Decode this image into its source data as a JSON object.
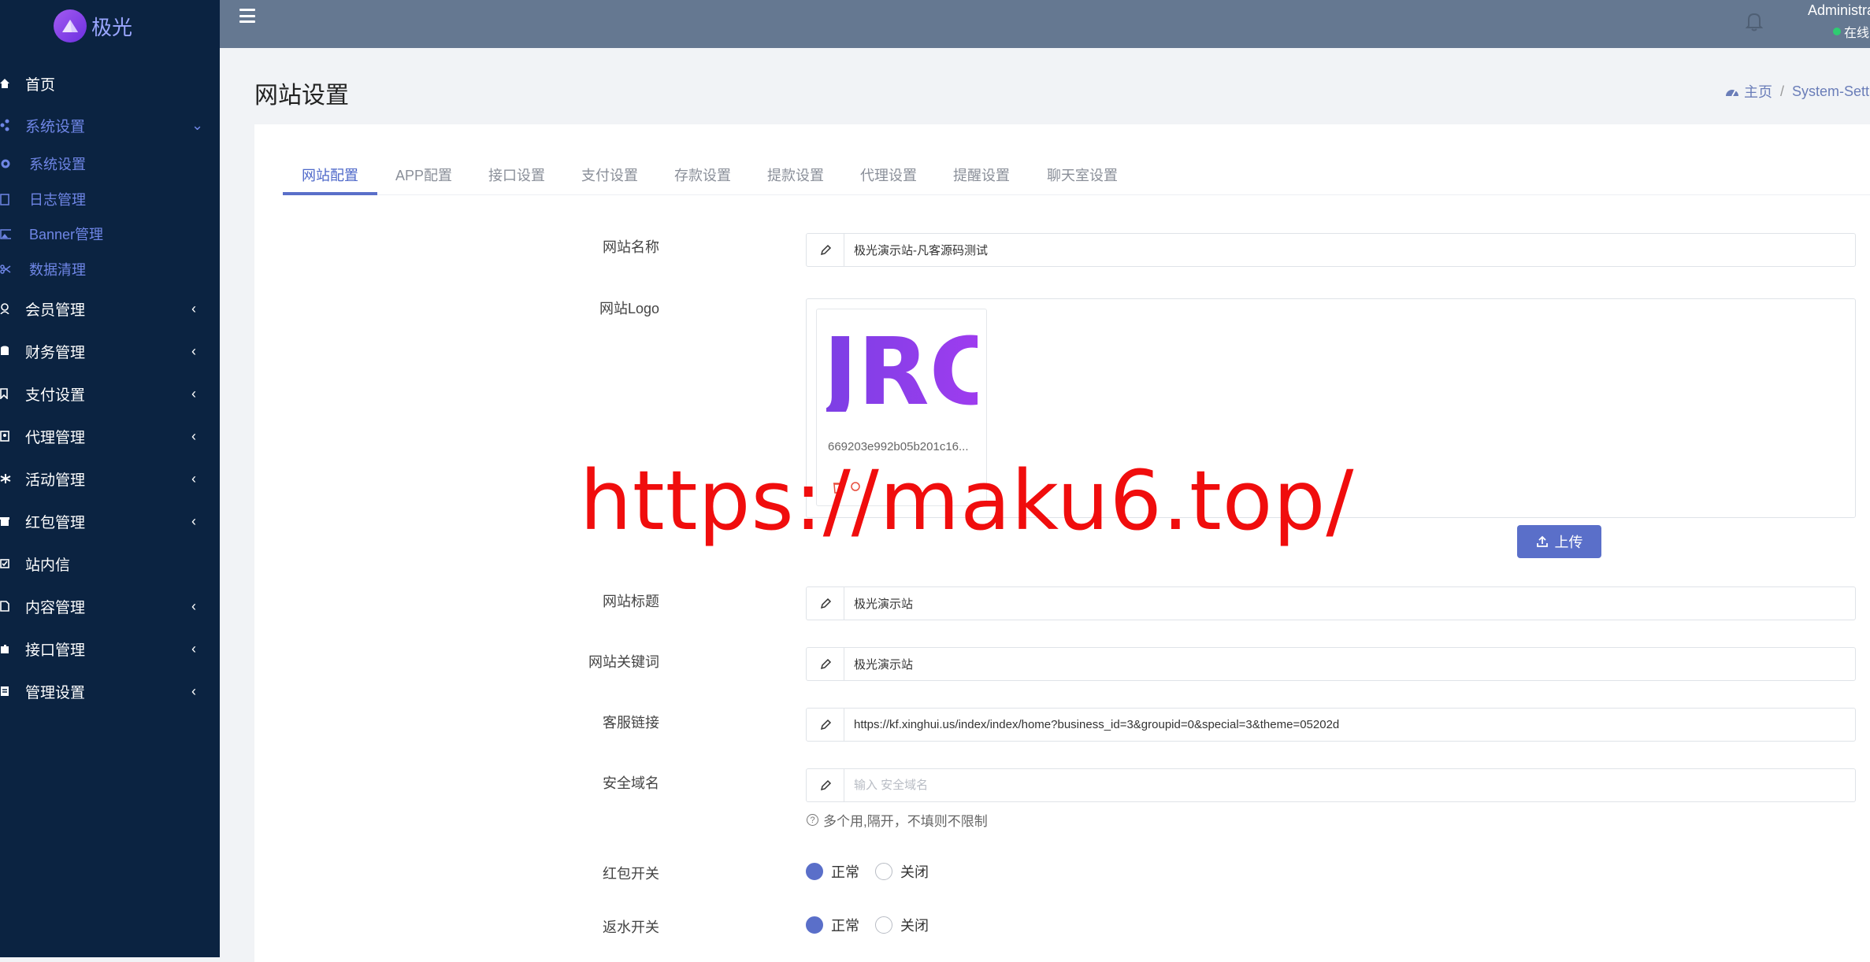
{
  "brand": {
    "name": "极光"
  },
  "sidebar": {
    "items": [
      {
        "label": "首页",
        "icon": "home-icon"
      },
      {
        "label": "系统设置",
        "icon": "share-icon",
        "open": true
      },
      {
        "label": "会员管理",
        "icon": "user-icon"
      },
      {
        "label": "财务管理",
        "icon": "database-icon"
      },
      {
        "label": "支付设置",
        "icon": "bookmark-icon"
      },
      {
        "label": "代理管理",
        "icon": "id-card-icon"
      },
      {
        "label": "活动管理",
        "icon": "asterisk-icon"
      },
      {
        "label": "红包管理",
        "icon": "gift-icon"
      },
      {
        "label": "站内信",
        "icon": "message-icon"
      },
      {
        "label": "内容管理",
        "icon": "file-icon"
      },
      {
        "label": "接口管理",
        "icon": "puzzle-icon"
      },
      {
        "label": "管理设置",
        "icon": "list-icon"
      }
    ],
    "subitems": [
      {
        "label": "系统设置",
        "icon": "gear-icon"
      },
      {
        "label": "日志管理",
        "icon": "doc-icon"
      },
      {
        "label": "Banner管理",
        "icon": "image-icon"
      },
      {
        "label": "数据清理",
        "icon": "scissors-icon"
      }
    ]
  },
  "header": {
    "admin_name": "Administrator",
    "admin_status": "在线"
  },
  "page": {
    "title": "网站设置",
    "breadcrumb_home": "主页",
    "breadcrumb_current": "System-Setti"
  },
  "tabs": [
    "网站配置",
    "APP配置",
    "接口设置",
    "支付设置",
    "存款设置",
    "提款设置",
    "代理设置",
    "提醒设置",
    "聊天室设置"
  ],
  "form": {
    "site_name_label": "网站名称",
    "site_name_value": "极光演示站-凡客源码测试",
    "site_logo_label": "网站Logo",
    "logo_text": "JRC",
    "logo_filename": "669203e992b05b201c16...",
    "upload_label": "上传",
    "site_title_label": "网站标题",
    "site_title_value": "极光演示站",
    "site_keywords_label": "网站关键词",
    "site_keywords_value": "极光演示站",
    "service_link_label": "客服链接",
    "service_link_value": "https://kf.xinghui.us/index/index/home?business_id=3&groupid=0&special=3&theme=05202d",
    "safe_domain_label": "安全域名",
    "safe_domain_placeholder": "输入 安全域名",
    "safe_domain_help": "多个用,隔开，不填则不限制",
    "redpacket_label": "红包开关",
    "rebate_label": "返水开关",
    "option_normal": "正常",
    "option_close": "关闭"
  },
  "watermark": "https://maku6.top/",
  "colors": {
    "sidebar_bg": "#0b2341",
    "header_bg": "#657891",
    "accent": "#5a6fc9",
    "watermark": "#f00d0d"
  }
}
